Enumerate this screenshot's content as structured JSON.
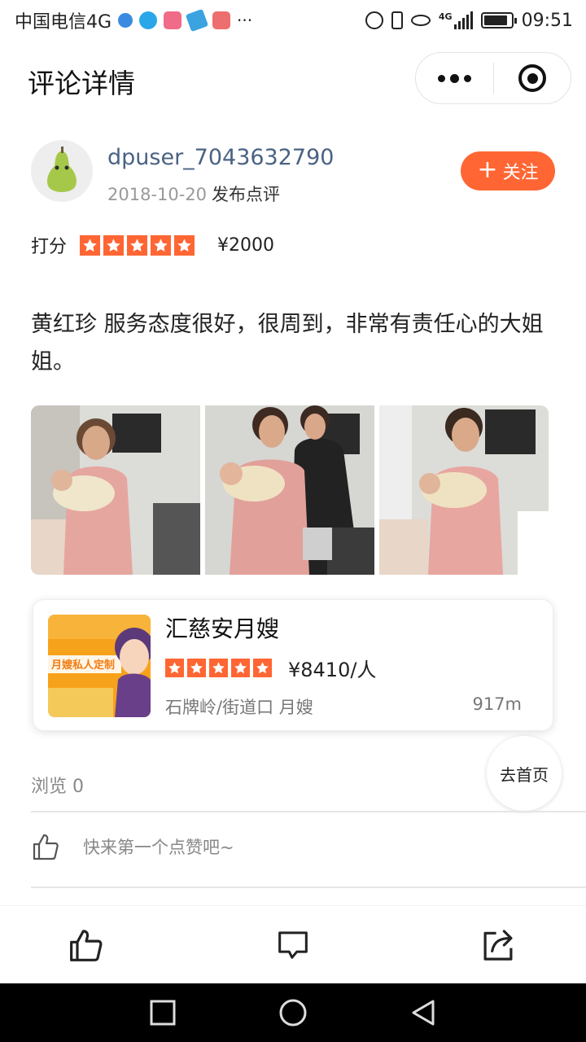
{
  "status_bar": {
    "carrier": "中国电信4G",
    "more": "···",
    "network": "4G",
    "time": "09:51"
  },
  "header": {
    "title": "评论详情"
  },
  "review": {
    "author": "dpuser_7043632790",
    "date": "2018-10-20",
    "action": "发布点评",
    "follow_label": "关注",
    "rating_label": "打分",
    "rating_stars": 5,
    "price": "¥2000",
    "text": "黄红珍 服务态度很好，很周到，非常有责任心的大姐姐。",
    "photos": [
      "photo-1",
      "photo-2",
      "photo-3"
    ]
  },
  "shop": {
    "name": "汇慈安月嫂",
    "stars": 5,
    "price": "¥8410/人",
    "location": "石牌岭/街道口  月嫂",
    "distance": "917m",
    "thumb_text": "月嫂私人定制"
  },
  "stats": {
    "views": "浏览 0",
    "home_label": "去首页",
    "like_prompt": "快来第一个点赞吧~"
  },
  "colors": {
    "accent": "#ff6633",
    "username": "#4a6283"
  },
  "icons": {
    "like": "thumbs-up-icon",
    "comment": "comment-icon",
    "share": "share-icon"
  }
}
